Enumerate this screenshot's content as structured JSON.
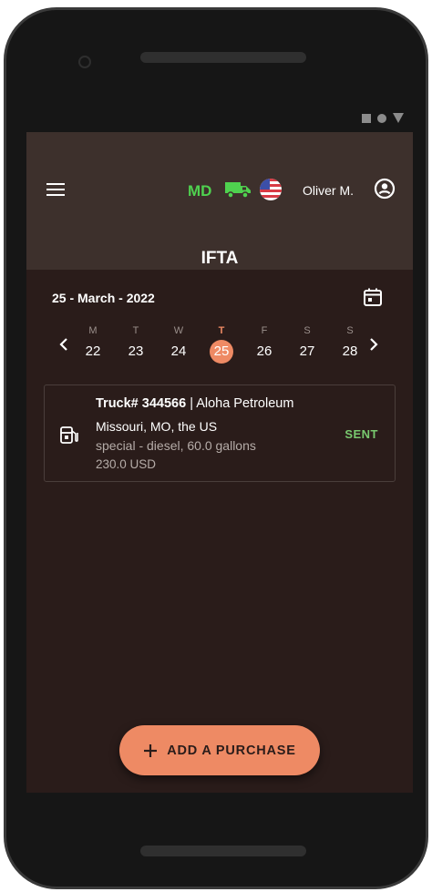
{
  "appbar": {
    "state_code": "MD",
    "user_name": "Oliver M.",
    "title": "IFTA"
  },
  "calendar": {
    "current_date": "25 - March - 2022",
    "days": [
      {
        "letter": "M",
        "number": "22"
      },
      {
        "letter": "T",
        "number": "23"
      },
      {
        "letter": "W",
        "number": "24"
      },
      {
        "letter": "T",
        "number": "25"
      },
      {
        "letter": "F",
        "number": "26"
      },
      {
        "letter": "S",
        "number": "27"
      },
      {
        "letter": "S",
        "number": "28"
      }
    ]
  },
  "purchase": {
    "truck": "Truck# 344566",
    "vendor": " | Aloha Petroleum",
    "location": "Missouri, MO, the US",
    "fuel": "special - diesel, 60.0 gallons",
    "price": "230.0 USD",
    "status": "SENT"
  },
  "fab": {
    "label": "ADD A PURCHASE"
  },
  "icons": [
    "menu-icon",
    "truck-icon",
    "us-flag-icon",
    "account-circle-icon",
    "calendar-icon",
    "chevron-left-icon",
    "chevron-right-icon",
    "fuel-pump-icon",
    "plus-icon"
  ],
  "colors": {
    "accent": "#ee8a64",
    "status_sent": "#79c96f",
    "state_code": "#4fd14f",
    "screen_bg": "#2a1c1a",
    "appbar_bg": "#3d302c"
  }
}
